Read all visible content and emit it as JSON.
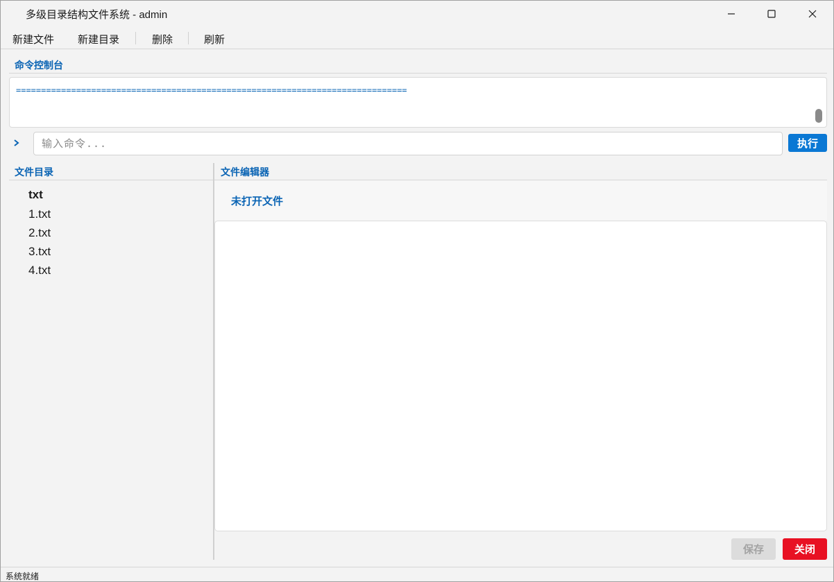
{
  "window": {
    "title": "多级目录结构文件系统 - admin",
    "controls": {
      "minimize_icon": "minimize-icon",
      "maximize_icon": "maximize-icon",
      "close_icon": "close-icon"
    }
  },
  "menu": {
    "items": [
      {
        "label": "新建文件"
      },
      {
        "label": "新建目录"
      },
      {
        "label": "删除"
      },
      {
        "label": "刷新"
      }
    ]
  },
  "console": {
    "label": "命令控制台",
    "output": "==============================================================================",
    "prompt": ">",
    "input_placeholder": "输入命令...",
    "input_value": "",
    "execute_label": "执行"
  },
  "directory": {
    "label": "文件目录",
    "root": "txt",
    "files": [
      "1.txt",
      "2.txt",
      "3.txt",
      "4.txt"
    ]
  },
  "editor": {
    "label": "文件编辑器",
    "current_file": "未打开文件",
    "content": "",
    "save_label": "保存",
    "close_label": "关闭"
  },
  "status": {
    "text": "系统就绪"
  },
  "colors": {
    "accent": "#0a64b4",
    "button_primary": "#0a78d4",
    "button_danger": "#e81123",
    "button_disabled": "#dcdcdc"
  }
}
